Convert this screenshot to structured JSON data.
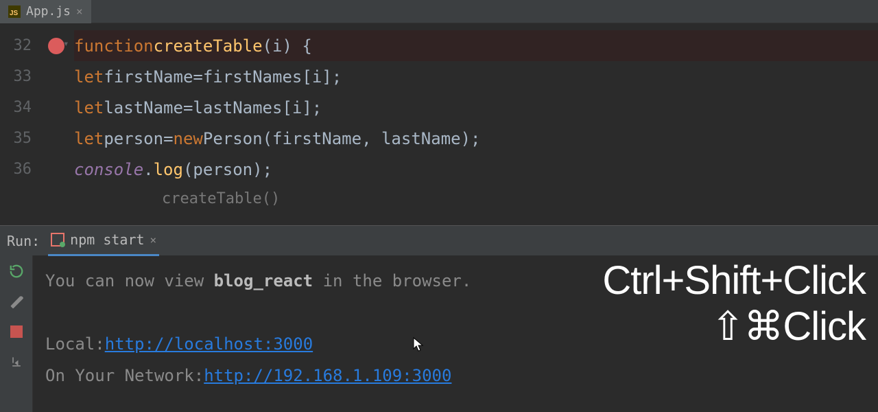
{
  "tab": {
    "filename": "App.js",
    "icon_label": "JS"
  },
  "lines": [
    {
      "num": "32"
    },
    {
      "num": "33"
    },
    {
      "num": "34"
    },
    {
      "num": "35"
    },
    {
      "num": "36"
    }
  ],
  "code": {
    "l32_kw": "function",
    "l32_fn": "createTable",
    "l32_param": "i",
    "let": "let",
    "l33_var": "firstName",
    "l33_rhs1": "firstNames",
    "l33_idx": "i",
    "l34_var": "lastName",
    "l34_rhs1": "lastNames",
    "l34_idx": "i",
    "l35_var": "person",
    "new": "new",
    "l35_type": "Person",
    "l35_a1": "firstName",
    "l35_a2": "lastName",
    "l36_obj": "console",
    "l36_fn": "log",
    "l36_arg": "person"
  },
  "hint": "createTable()",
  "run": {
    "label": "Run:",
    "tab_label": "npm start"
  },
  "console": {
    "line1_pre": "You can now view ",
    "line1_bold": "blog_react",
    "line1_post": " in the browser.",
    "local_label": "Local:",
    "local_url": "http://localhost:3000",
    "net_label": "On Your Network:",
    "net_url": "http://192.168.1.109:3000"
  },
  "overlay": {
    "line1": "Ctrl+Shift+Click",
    "line2": "⇧⌘Click"
  }
}
